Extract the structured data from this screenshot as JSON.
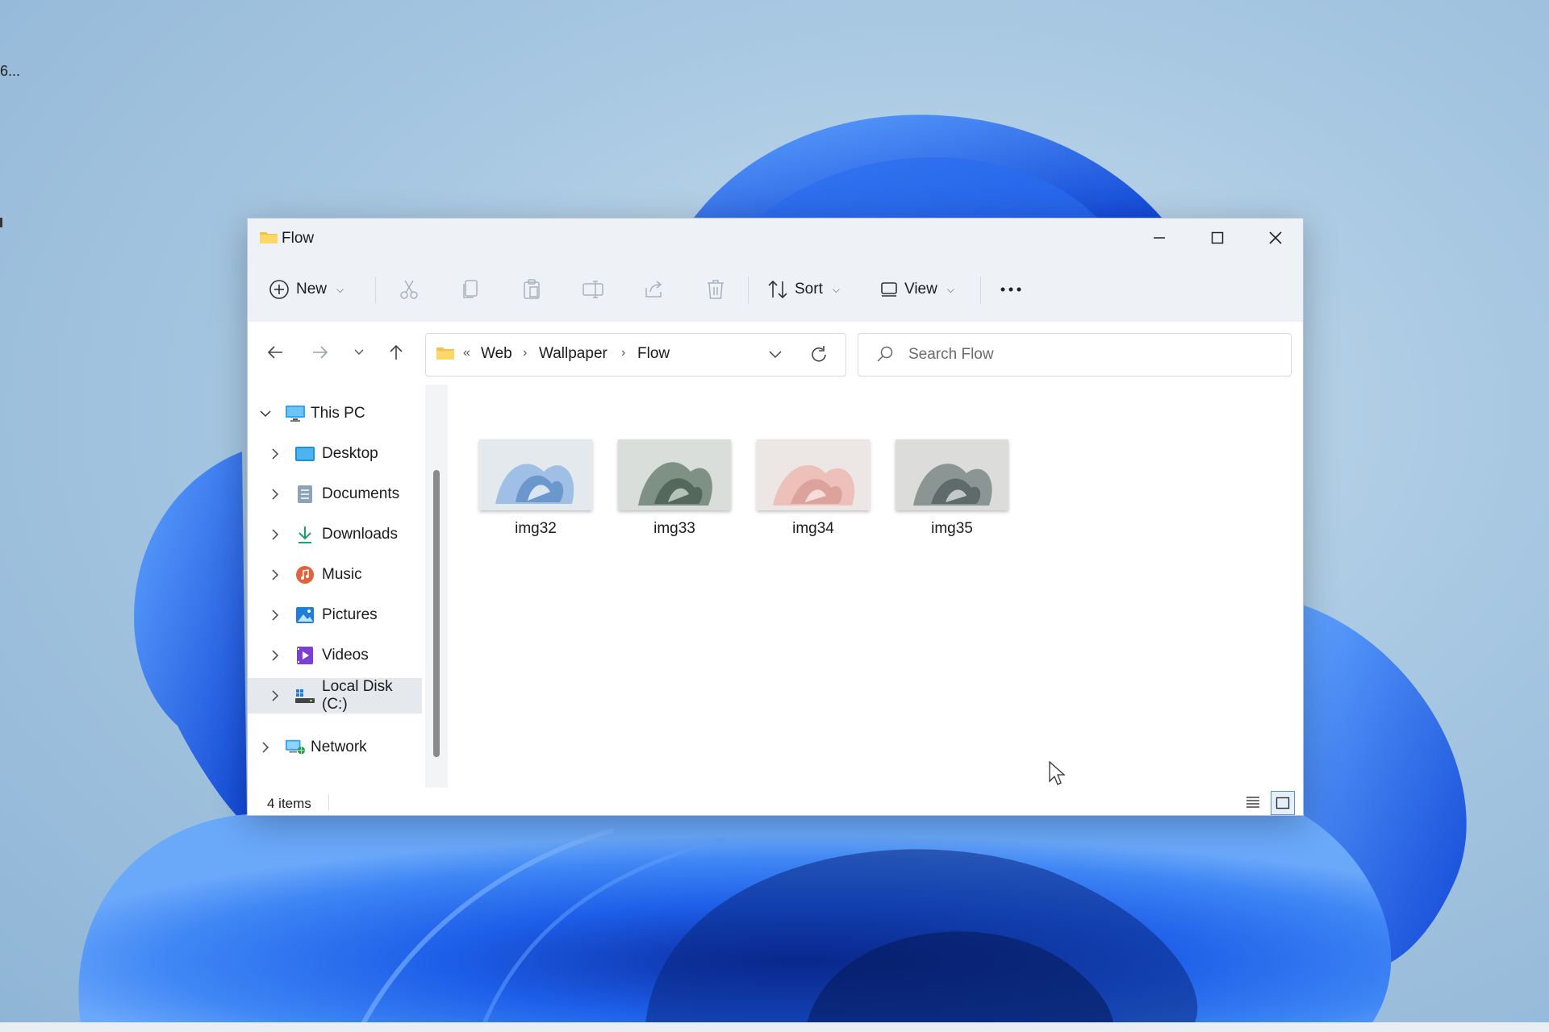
{
  "desktop": {
    "icon_label": "6...",
    "wallpaper_color": "#1d5ee8"
  },
  "window": {
    "title": "Flow",
    "controls": {
      "minimize": "minimize-icon",
      "maximize": "maximize-icon",
      "close": "close-icon"
    }
  },
  "commandbar": {
    "new_label": "New",
    "sort_label": "Sort",
    "view_label": "View",
    "icons": [
      "plus-circle-icon",
      "cut-icon",
      "copy-icon",
      "paste-icon",
      "rename-icon",
      "share-icon",
      "delete-icon",
      "sort-icon",
      "view-icon",
      "more-icon"
    ]
  },
  "address": {
    "overflow": "«",
    "crumbs": [
      "Web",
      "Wallpaper",
      "Flow"
    ],
    "separator": "›"
  },
  "search": {
    "placeholder": "Search Flow"
  },
  "navpane": {
    "items": [
      {
        "label": "This PC",
        "icon": "monitor-icon",
        "expanded": true
      },
      {
        "label": "Desktop",
        "icon": "desktop-icon"
      },
      {
        "label": "Documents",
        "icon": "documents-icon"
      },
      {
        "label": "Downloads",
        "icon": "download-icon"
      },
      {
        "label": "Music",
        "icon": "music-icon"
      },
      {
        "label": "Pictures",
        "icon": "pictures-icon"
      },
      {
        "label": "Videos",
        "icon": "videos-icon"
      },
      {
        "label": "Local Disk (C:)",
        "icon": "drive-icon",
        "selected": true
      },
      {
        "label": "Network",
        "icon": "network-icon"
      }
    ]
  },
  "files": [
    {
      "name": "img32",
      "accent": "#8fb3da"
    },
    {
      "name": "img33",
      "accent": "#6f8577"
    },
    {
      "name": "img34",
      "accent": "#e3b6b0"
    },
    {
      "name": "img35",
      "accent": "#7d8a8a"
    }
  ],
  "statusbar": {
    "count": "4 items",
    "active_view": "large-icons"
  }
}
